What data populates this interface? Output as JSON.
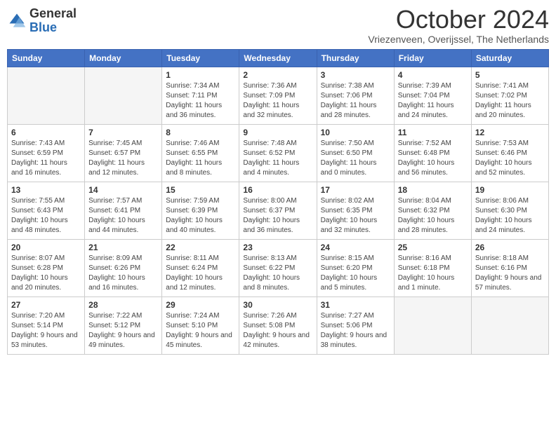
{
  "header": {
    "logo_general": "General",
    "logo_blue": "Blue",
    "month_title": "October 2024",
    "subtitle": "Vriezenveen, Overijssel, The Netherlands"
  },
  "weekdays": [
    "Sunday",
    "Monday",
    "Tuesday",
    "Wednesday",
    "Thursday",
    "Friday",
    "Saturday"
  ],
  "weeks": [
    [
      {
        "day": "",
        "info": ""
      },
      {
        "day": "",
        "info": ""
      },
      {
        "day": "1",
        "info": "Sunrise: 7:34 AM\nSunset: 7:11 PM\nDaylight: 11 hours and 36 minutes."
      },
      {
        "day": "2",
        "info": "Sunrise: 7:36 AM\nSunset: 7:09 PM\nDaylight: 11 hours and 32 minutes."
      },
      {
        "day": "3",
        "info": "Sunrise: 7:38 AM\nSunset: 7:06 PM\nDaylight: 11 hours and 28 minutes."
      },
      {
        "day": "4",
        "info": "Sunrise: 7:39 AM\nSunset: 7:04 PM\nDaylight: 11 hours and 24 minutes."
      },
      {
        "day": "5",
        "info": "Sunrise: 7:41 AM\nSunset: 7:02 PM\nDaylight: 11 hours and 20 minutes."
      }
    ],
    [
      {
        "day": "6",
        "info": "Sunrise: 7:43 AM\nSunset: 6:59 PM\nDaylight: 11 hours and 16 minutes."
      },
      {
        "day": "7",
        "info": "Sunrise: 7:45 AM\nSunset: 6:57 PM\nDaylight: 11 hours and 12 minutes."
      },
      {
        "day": "8",
        "info": "Sunrise: 7:46 AM\nSunset: 6:55 PM\nDaylight: 11 hours and 8 minutes."
      },
      {
        "day": "9",
        "info": "Sunrise: 7:48 AM\nSunset: 6:52 PM\nDaylight: 11 hours and 4 minutes."
      },
      {
        "day": "10",
        "info": "Sunrise: 7:50 AM\nSunset: 6:50 PM\nDaylight: 11 hours and 0 minutes."
      },
      {
        "day": "11",
        "info": "Sunrise: 7:52 AM\nSunset: 6:48 PM\nDaylight: 10 hours and 56 minutes."
      },
      {
        "day": "12",
        "info": "Sunrise: 7:53 AM\nSunset: 6:46 PM\nDaylight: 10 hours and 52 minutes."
      }
    ],
    [
      {
        "day": "13",
        "info": "Sunrise: 7:55 AM\nSunset: 6:43 PM\nDaylight: 10 hours and 48 minutes."
      },
      {
        "day": "14",
        "info": "Sunrise: 7:57 AM\nSunset: 6:41 PM\nDaylight: 10 hours and 44 minutes."
      },
      {
        "day": "15",
        "info": "Sunrise: 7:59 AM\nSunset: 6:39 PM\nDaylight: 10 hours and 40 minutes."
      },
      {
        "day": "16",
        "info": "Sunrise: 8:00 AM\nSunset: 6:37 PM\nDaylight: 10 hours and 36 minutes."
      },
      {
        "day": "17",
        "info": "Sunrise: 8:02 AM\nSunset: 6:35 PM\nDaylight: 10 hours and 32 minutes."
      },
      {
        "day": "18",
        "info": "Sunrise: 8:04 AM\nSunset: 6:32 PM\nDaylight: 10 hours and 28 minutes."
      },
      {
        "day": "19",
        "info": "Sunrise: 8:06 AM\nSunset: 6:30 PM\nDaylight: 10 hours and 24 minutes."
      }
    ],
    [
      {
        "day": "20",
        "info": "Sunrise: 8:07 AM\nSunset: 6:28 PM\nDaylight: 10 hours and 20 minutes."
      },
      {
        "day": "21",
        "info": "Sunrise: 8:09 AM\nSunset: 6:26 PM\nDaylight: 10 hours and 16 minutes."
      },
      {
        "day": "22",
        "info": "Sunrise: 8:11 AM\nSunset: 6:24 PM\nDaylight: 10 hours and 12 minutes."
      },
      {
        "day": "23",
        "info": "Sunrise: 8:13 AM\nSunset: 6:22 PM\nDaylight: 10 hours and 8 minutes."
      },
      {
        "day": "24",
        "info": "Sunrise: 8:15 AM\nSunset: 6:20 PM\nDaylight: 10 hours and 5 minutes."
      },
      {
        "day": "25",
        "info": "Sunrise: 8:16 AM\nSunset: 6:18 PM\nDaylight: 10 hours and 1 minute."
      },
      {
        "day": "26",
        "info": "Sunrise: 8:18 AM\nSunset: 6:16 PM\nDaylight: 9 hours and 57 minutes."
      }
    ],
    [
      {
        "day": "27",
        "info": "Sunrise: 7:20 AM\nSunset: 5:14 PM\nDaylight: 9 hours and 53 minutes."
      },
      {
        "day": "28",
        "info": "Sunrise: 7:22 AM\nSunset: 5:12 PM\nDaylight: 9 hours and 49 minutes."
      },
      {
        "day": "29",
        "info": "Sunrise: 7:24 AM\nSunset: 5:10 PM\nDaylight: 9 hours and 45 minutes."
      },
      {
        "day": "30",
        "info": "Sunrise: 7:26 AM\nSunset: 5:08 PM\nDaylight: 9 hours and 42 minutes."
      },
      {
        "day": "31",
        "info": "Sunrise: 7:27 AM\nSunset: 5:06 PM\nDaylight: 9 hours and 38 minutes."
      },
      {
        "day": "",
        "info": ""
      },
      {
        "day": "",
        "info": ""
      }
    ]
  ]
}
